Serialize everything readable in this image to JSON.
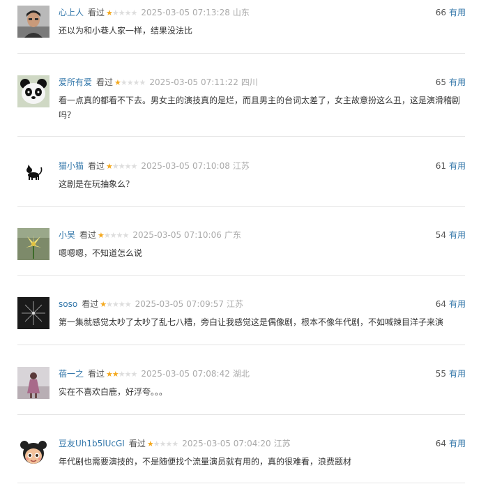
{
  "action_label": "有用",
  "watched_label": "看过",
  "colors": {
    "link": "#3377aa",
    "star": "#f4a81d",
    "star_empty": "#dddddd",
    "meta": "#aaaaaa",
    "divider": "#e5e5e5"
  },
  "comments": [
    {
      "user": "心上人",
      "rating": 1,
      "time": "2025-03-05 07:13:28",
      "location": "山东",
      "votes": "66",
      "text": "还以为和小巷人家一样，结果没法比",
      "avatar": "portrait-avatar"
    },
    {
      "user": "爱所有爱",
      "rating": 1,
      "time": "2025-03-05 07:11:22",
      "location": "四川",
      "votes": "65",
      "text": "看一点真的都看不下去。男女主的演技真的是烂，而且男主的台词太差了，女主故意扮这么丑，这是演滑稽剧吗？",
      "avatar": "panda-avatar"
    },
    {
      "user": "猫小猫",
      "rating": 1,
      "time": "2025-03-05 07:10:08",
      "location": "江苏",
      "votes": "61",
      "text": "这剧是在玩抽象么？",
      "avatar": "black-cat-avatar"
    },
    {
      "user": "小吴",
      "rating": 1,
      "time": "2025-03-05 07:10:06",
      "location": "广东",
      "votes": "54",
      "text": "嗯嗯嗯，不知道怎么说",
      "avatar": "lily-flower-avatar"
    },
    {
      "user": "soso",
      "rating": 1,
      "time": "2025-03-05 07:09:57",
      "location": "江苏",
      "votes": "64",
      "text": "第一集就感觉太吵了太吵了乱七八糟，旁白让我感觉这是偶像剧，根本不像年代剧，不如喊辣目洋子来演",
      "avatar": "firework-avatar"
    },
    {
      "user": "蓓一之",
      "rating": 2,
      "time": "2025-03-05 07:08:42",
      "location": "湖北",
      "votes": "55",
      "text": "实在不喜欢白鹿，好浮夸。。。",
      "avatar": "girl-photo-avatar"
    },
    {
      "user": "豆友Uh1b5lUcGI",
      "rating": 1,
      "time": "2025-03-05 07:04:20",
      "location": "江苏",
      "votes": "64",
      "text": "年代剧也需要演技的，不是随便找个流量演员就有用的，真的很难看，浪费题材",
      "avatar": "cartoon-girl-avatar"
    }
  ]
}
